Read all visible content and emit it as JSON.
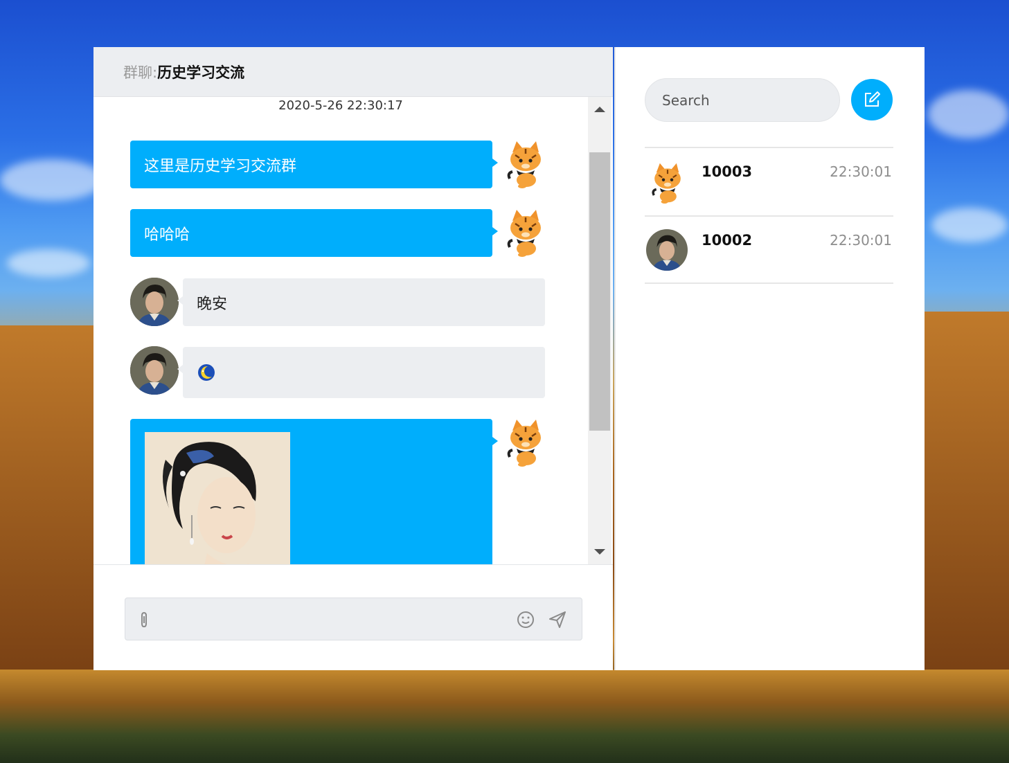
{
  "header": {
    "prefix": "群聊:",
    "title": "历史学习交流"
  },
  "messages": {
    "timestamp": "2020-5-26 22:30:17",
    "items": [
      {
        "direction": "out",
        "type": "text",
        "text": "这里是历史学习交流群",
        "avatar": "tiger-cat-avatar"
      },
      {
        "direction": "out",
        "type": "text",
        "text": "哈哈哈",
        "avatar": "tiger-cat-avatar"
      },
      {
        "direction": "in",
        "type": "text",
        "text": "晚安",
        "avatar": "man-portrait-avatar"
      },
      {
        "direction": "in",
        "type": "emoji",
        "emoji": "moon-emoji",
        "avatar": "man-portrait-avatar"
      },
      {
        "direction": "out",
        "type": "image",
        "image": "woman-painting-image",
        "avatar": "tiger-cat-avatar"
      }
    ]
  },
  "composer": {
    "placeholder": "",
    "icons": [
      "paperclip-icon",
      "smiley-icon",
      "send-icon"
    ]
  },
  "sidebar": {
    "search_placeholder": "Search",
    "compose_icon": "edit-icon",
    "contacts": [
      {
        "name": "10003",
        "time": "22:30:01",
        "avatar": "tiger-cat-avatar"
      },
      {
        "name": "10002",
        "time": "22:30:01",
        "avatar": "man-portrait-avatar"
      }
    ]
  },
  "colors": {
    "accent": "#00aefc",
    "bubble_in": "#eceef1",
    "header_bg": "#eceef1"
  }
}
